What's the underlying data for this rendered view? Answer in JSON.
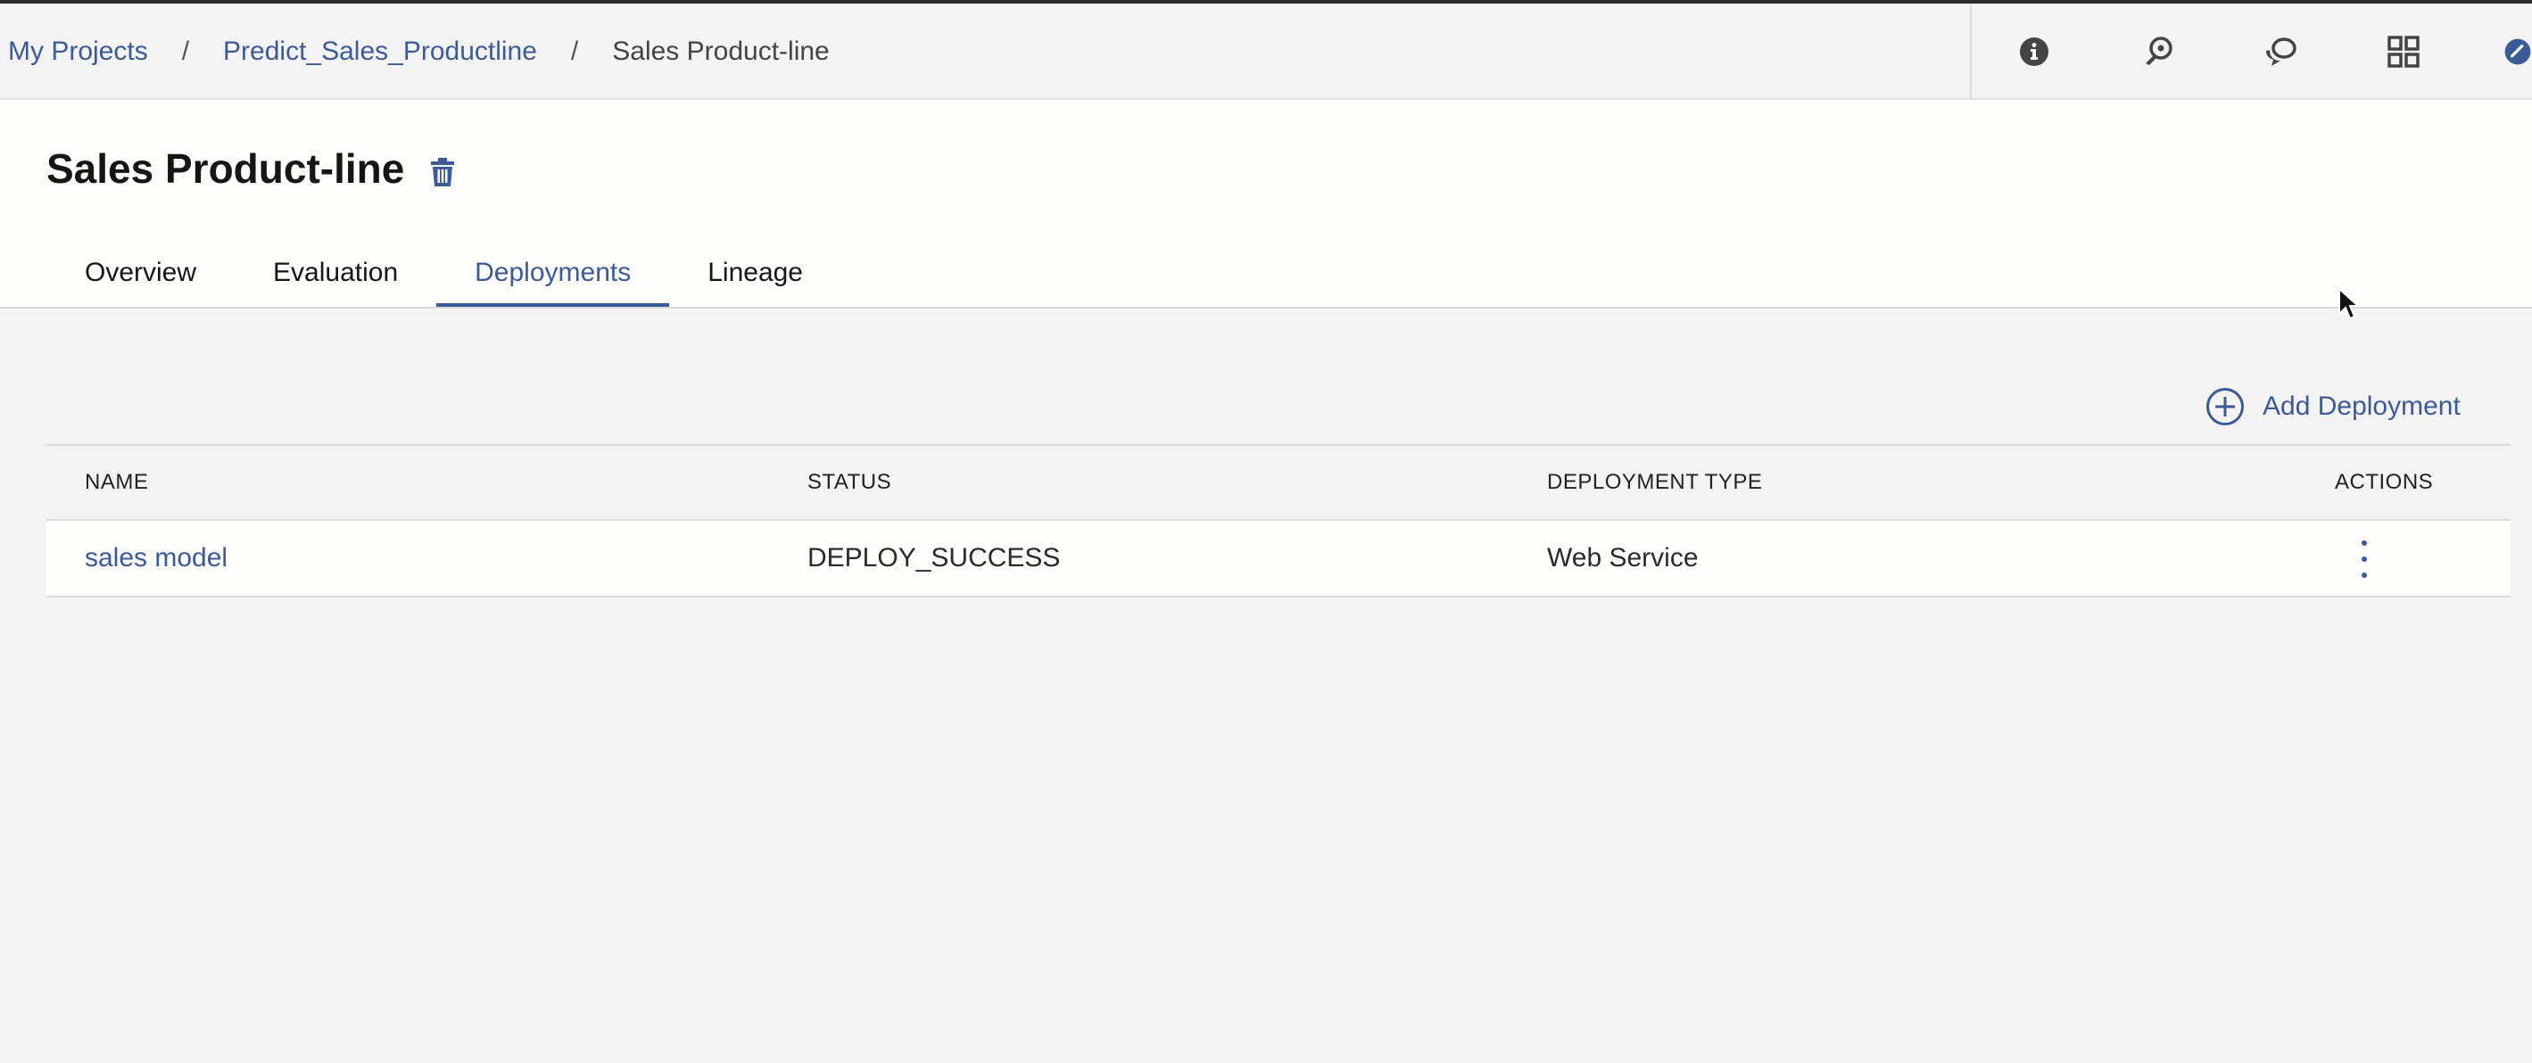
{
  "breadcrumb": {
    "items": [
      {
        "label": "My Projects"
      },
      {
        "label": "Predict_Sales_Productline"
      }
    ],
    "separator": "/",
    "current": "Sales Product-line"
  },
  "toolbar": {
    "icons": [
      "info-icon",
      "feedback-icon",
      "chat-icon",
      "apps-grid-icon",
      "user-avatar-icon"
    ]
  },
  "page": {
    "title": "Sales Product-line",
    "delete_icon": "trash-icon"
  },
  "tabs": [
    {
      "label": "Overview",
      "active": false
    },
    {
      "label": "Evaluation",
      "active": false
    },
    {
      "label": "Deployments",
      "active": true
    },
    {
      "label": "Lineage",
      "active": false
    }
  ],
  "actions": {
    "add_deployment_label": "Add Deployment",
    "add_icon": "plus-circle-icon"
  },
  "table": {
    "headers": {
      "name": "NAME",
      "status": "STATUS",
      "type": "DEPLOYMENT TYPE",
      "actions": "ACTIONS"
    },
    "rows": [
      {
        "name": "sales model",
        "status": "DEPLOY_SUCCESS",
        "type": "Web Service",
        "actions_icon": "overflow-menu-icon"
      }
    ]
  },
  "colors": {
    "accent": "#3b5b98",
    "background": "#f3f3f4",
    "panel": "#fdfdfb",
    "text": "#161616"
  }
}
